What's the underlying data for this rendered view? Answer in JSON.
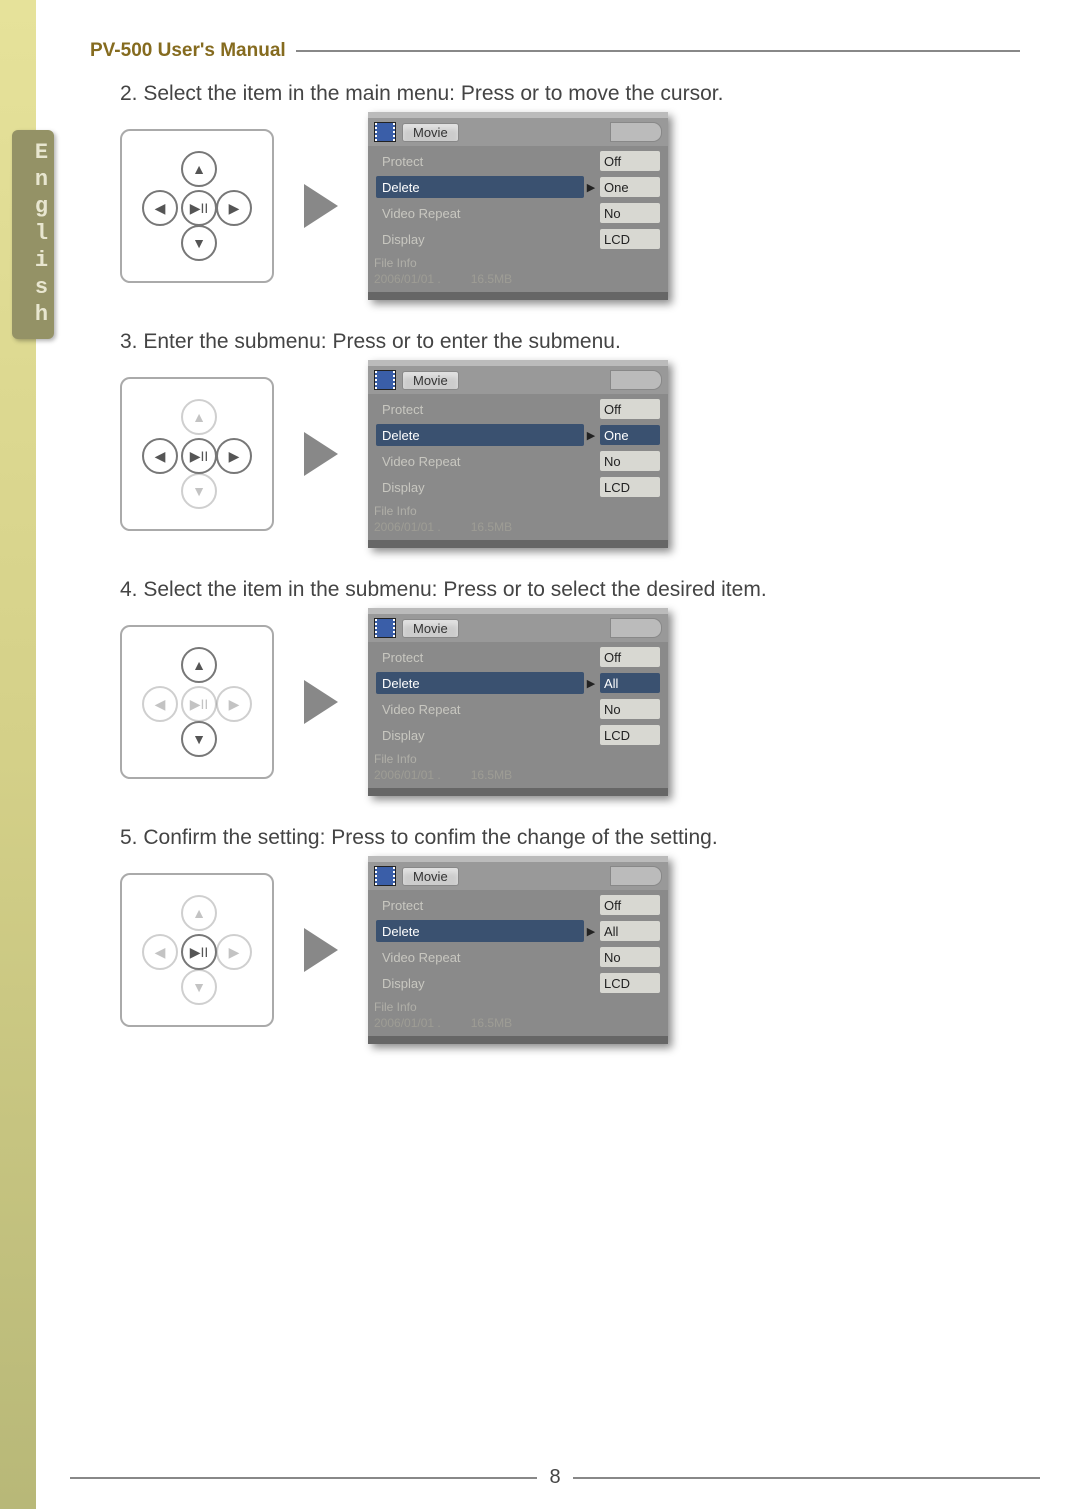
{
  "header": {
    "title": "PV-500 User's Manual"
  },
  "sidebar": {
    "language": "English"
  },
  "steps": {
    "s2": "2. Select the item in the main menu: Press    or    to move the cursor.",
    "s3": "3. Enter the submenu: Press    or      to enter the submenu.",
    "s4": "4. Select the item in the submenu: Press    or    to select the desired item.",
    "s5": "5. Confirm the setting: Press      to confim the change of the setting."
  },
  "screen_title": "Movie",
  "menu_labels": {
    "protect": "Protect",
    "delete": "Delete",
    "repeat": "Video Repeat",
    "display": "Display",
    "fileinfo": "File Info"
  },
  "file_info": {
    "date": "2006/01/01 .",
    "size": "16.5MB"
  },
  "screens": {
    "a": {
      "protect": "Off",
      "delete": "One",
      "repeat": "No",
      "display": "LCD",
      "val_sel": ""
    },
    "b": {
      "protect": "Off",
      "delete": "One",
      "repeat": "No",
      "display": "LCD",
      "val_sel": "delete"
    },
    "c": {
      "protect": "Off",
      "delete": "All",
      "repeat": "No",
      "display": "LCD",
      "val_sel": "delete"
    },
    "d": {
      "protect": "Off",
      "delete": "All",
      "repeat": "No",
      "display": "LCD",
      "val_sel": ""
    }
  },
  "footer": {
    "page": "8"
  }
}
